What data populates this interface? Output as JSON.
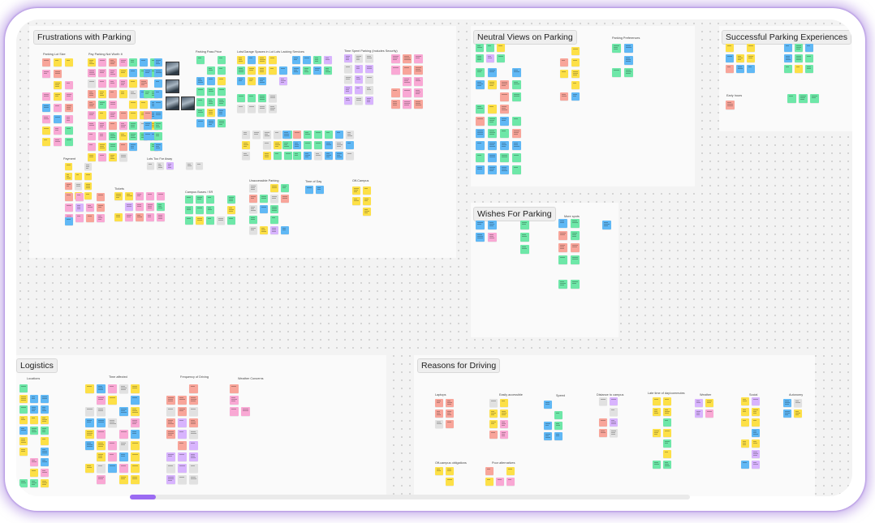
{
  "board": {
    "colors": {
      "yellow": "#fde047",
      "pink": "#f9a8d4",
      "green": "#6ee7a8",
      "blue": "#60b8f5",
      "purple": "#d8b4fe",
      "salmon": "#f8a59a",
      "gray": "#e1e1e1",
      "accent": "#9b6bf2"
    },
    "sections": {
      "frustrations": {
        "title": "Frustrations with Parking",
        "groups": [
          "Parking Lot Size",
          "Pay Parking Not Worth It",
          "Parking Pass Price",
          "Time Spent Parking (Includes Security)",
          "Lots/Garage Spaces in Lot Lots Lacking Services",
          "Payment",
          "Lots Too Far Away",
          "Tickets",
          "Campus Buses / SR",
          "Unaccessible Parking",
          "Time of Day",
          "Off-Campus"
        ]
      },
      "neutral": {
        "title": "Neutral Views on Parking",
        "groups": [
          "Parking Preferences"
        ]
      },
      "successful": {
        "title": "Successful Parking Experiences",
        "groups": [
          "Early hours"
        ]
      },
      "wishes": {
        "title": "Wishes For Parking",
        "groups": [
          "More spots"
        ]
      },
      "logistics": {
        "title": "Logistics",
        "groups": [
          "Locations",
          "Time affected",
          "Frequency of Driving",
          "Weather Concerns"
        ]
      },
      "reasons": {
        "title": "Reasons for Driving",
        "groups": [
          "Laptops",
          "Easily accessible",
          "Speed",
          "Distance to campus",
          "Late time of day/commutes",
          "Weather",
          "Social",
          "Autonomy",
          "Off-campus obligations",
          "Poor alternatives"
        ]
      }
    }
  }
}
